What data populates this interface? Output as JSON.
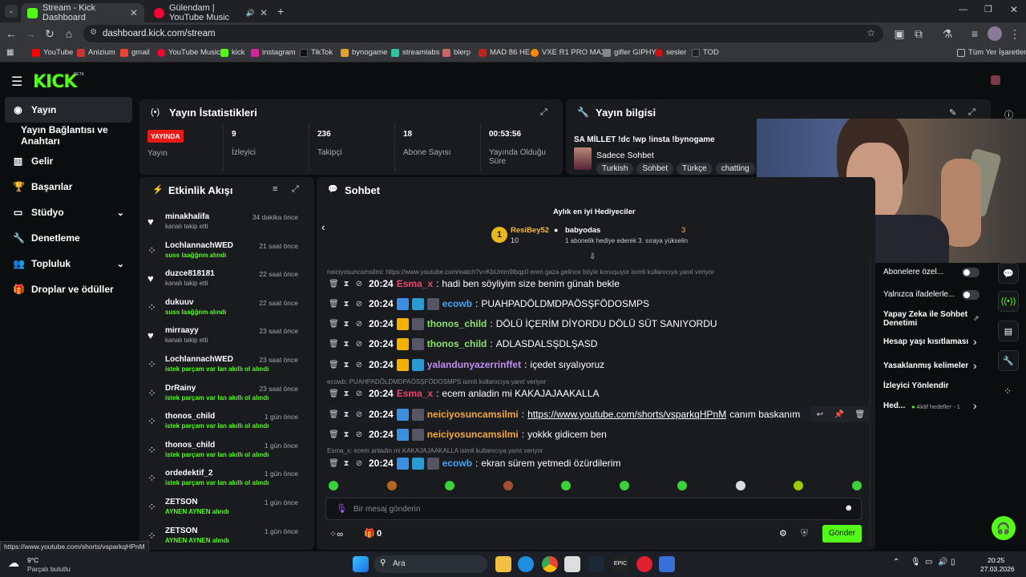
{
  "browser": {
    "tabs": [
      {
        "title": "Stream - Kick Dashboard"
      },
      {
        "title": "Gülendam | YouTube Music"
      }
    ],
    "url": "dashboard.kick.com/stream",
    "bookmarks": [
      "YouTube",
      "Anizium",
      "gmail",
      "YouTube Music",
      "kick",
      "instagram",
      "TikTok",
      "bynogame",
      "streamlabs",
      "blerp",
      "MAD 86 HE",
      "VXE R1 PRO MAX",
      "gifler GIPHY",
      "sesler",
      "TOD"
    ],
    "all_bookmarks": "Tüm Yer İşaretleri"
  },
  "logo": "KICK",
  "beta": "BETA",
  "sidebar": [
    {
      "label": "Yayın",
      "icon": "broadcast-icon"
    },
    {
      "label": "Yayın Bağlantısı ve Anahtarı",
      "icon": ""
    },
    {
      "label": "Gelir",
      "icon": "chart-icon"
    },
    {
      "label": "Başarılar",
      "icon": "trophy-icon"
    },
    {
      "label": "Stüdyo",
      "icon": "studio-icon"
    },
    {
      "label": "Denetleme",
      "icon": "wrench-icon"
    },
    {
      "label": "Topluluk",
      "icon": "people-icon"
    },
    {
      "label": "Droplar ve ödüller",
      "icon": "gift-icon"
    }
  ],
  "stats": {
    "title": "Yayın İstatistikleri",
    "live": "YAYINDA",
    "live_label": "Yayın",
    "viewers": "9",
    "viewers_label": "İzleyici",
    "followers": "236",
    "followers_label": "Takipçi",
    "subs": "18",
    "subs_label": "Abone Sayısı",
    "uptime": "00:53:56",
    "uptime_label": "Yayında Olduğu Süre"
  },
  "info": {
    "title": "Yayın bilgisi",
    "stream_title": "SA MİLLET !dc !wp !insta !bynogame",
    "category": "Sadece Sohbet",
    "tags": [
      "Turkish",
      "Sohbet",
      "Türkçe",
      "chatting"
    ]
  },
  "activity": {
    "title": "Etkinlik Akışı",
    "items": [
      {
        "name": "minakhalifa",
        "sub": "kanalı takip etti",
        "time": "34 dakika önce",
        "green": false
      },
      {
        "name": "LochlannachWED",
        "sub": "suss laağğnm alındı",
        "time": "21 saat önce",
        "green": true
      },
      {
        "name": "duzce818181",
        "sub": "kanalı takip etti",
        "time": "22 saat önce",
        "green": false
      },
      {
        "name": "dukuuv",
        "sub": "suss laağğnm alındı",
        "time": "22 saat önce",
        "green": true
      },
      {
        "name": "mirraayy",
        "sub": "kanalı takip etti",
        "time": "23 saat önce",
        "green": false
      },
      {
        "name": "LochlannachWED",
        "sub": "istek parçam var lan akıllı ol alındı",
        "time": "23 saat önce",
        "green": true
      },
      {
        "name": "DrRainy",
        "sub": "istek parçam var lan akıllı ol alındı",
        "time": "23 saat önce",
        "green": true
      },
      {
        "name": "thonos_child",
        "sub": "istek parçam var lan akıllı ol alındı",
        "time": "1 gün önce",
        "green": true
      },
      {
        "name": "thonos_child",
        "sub": "istek parçam var lan akıllı ol alındı",
        "time": "1 gün önce",
        "green": true
      },
      {
        "name": "ordedektif_2",
        "sub": "istek parçam var lan akıllı ol alındı",
        "time": "1 gün önce",
        "green": true
      },
      {
        "name": "ZETSON",
        "sub": "AYNEN AYNEN alındı",
        "time": "1 gün önce",
        "green": true
      },
      {
        "name": "ZETSON",
        "sub": "AYNEN AYNEN alındı",
        "time": "1 gün önce",
        "green": true
      }
    ]
  },
  "chat": {
    "title": "Sohbet",
    "gifters_title": "Aylık en iyi Hediyeciler",
    "gifter1": "ResiBey52",
    "gifter1_count": "10",
    "gifter2": "babyodas",
    "gifter2_count": "3",
    "gifter2_note": "1 abonelik hediye ederek 3. sıraya yükselin",
    "replies": [
      "neiciyosuncamsilmi: https://www.youtube.com/watch?v=KbUmm9lbqp0 eren gaza gelince böyle konuşuyor isimli kullanıcıya yanıt veriyor",
      "ecowb: PUAHPADÖLDMDPAÖSŞFÖDOSMPS isimli kullanıcıya yanıt veriyor",
      "Esma_x: ecem anladin mi KAKAJAJAAKALLA isimli kullanıcıya yanıt veriyor"
    ],
    "messages": [
      {
        "time": "20:24",
        "user": "Esma_x",
        "color": "#e9456b",
        "text": "hadi ben söyliyim size benim günah bekle"
      },
      {
        "time": "20:24",
        "user": "ecowb",
        "color": "#43a7f7",
        "text": "PUAHPADÖLDMDPAÖSŞFÖDOSMPS"
      },
      {
        "time": "20:24",
        "user": "thonos_child",
        "color": "#8be26a",
        "text": "DÖLÜ İÇERİM DİYORDU DÖLÜ SÜT SANIYORDU"
      },
      {
        "time": "20:24",
        "user": "thonos_child",
        "color": "#8be26a",
        "text": "ADLASDALSŞDLŞASD"
      },
      {
        "time": "20:24",
        "user": "yalandunyazerrinffet",
        "color": "#c58cf5",
        "text": "içedet sıyalıyoruz"
      },
      {
        "time": "20:24",
        "user": "Esma_x",
        "color": "#e9456b",
        "text": "ecem anladin mi KAKAJAJAAKALLA"
      },
      {
        "time": "20:24",
        "user": "neiciyosuncamsilmi",
        "color": "#f5a742",
        "text": "https://www.youtube.com/shorts/vsparkqHPnM",
        "extra": "canım baskanım"
      },
      {
        "time": "20:24",
        "user": "neiciyosuncamsilmi",
        "color": "#f5a742",
        "text": "yokkk gidicem ben"
      },
      {
        "time": "20:24",
        "user": "ecowb",
        "color": "#43a7f7",
        "text": "ekran sürem yetmedi özürdilerim"
      }
    ],
    "placeholder": "Bir mesaj gönderin",
    "points": "0",
    "send": "Gönder"
  },
  "right": {
    "items": [
      "Abonelere özel...",
      "Yalnızca ifadelerle...",
      "Yapay Zeka ile Sohbet Denetimi",
      "Hesap yaşı kısıtlaması",
      "Yasaklanmış kelimeler",
      "İzleyici Yönlendir",
      "Hed..."
    ],
    "targets": "Aktif hedefler - 1"
  },
  "statusbar": "https://www.youtube.com/shorts/vsparkqHPnM",
  "taskbar": {
    "temp": "9°C",
    "weather": "Parçalı bulutlu",
    "search": "Ara",
    "time": "20:25",
    "date": "27.03.2026"
  },
  "colors": {
    "accent": "#53fc18",
    "live": "#e91916"
  }
}
